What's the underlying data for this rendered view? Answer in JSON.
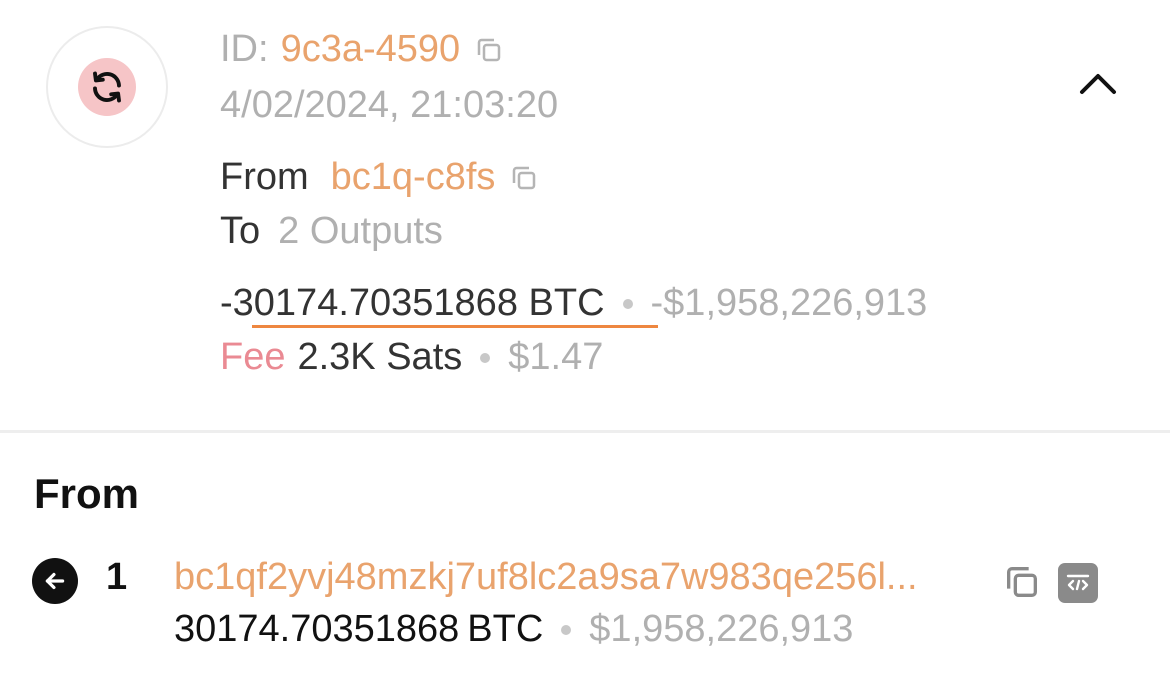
{
  "tx": {
    "id_label": "ID:",
    "id_value": "9c3a-4590",
    "datetime": "4/02/2024, 21:03:20",
    "from_label": "From",
    "from_address": "bc1q-c8fs",
    "to_label": "To",
    "to_value": "2 Outputs",
    "amount": "-30174.70351868 BTC",
    "amount_usd": "-$1,958,226,913",
    "fee_label": "Fee",
    "fee_value": "2.3K Sats",
    "fee_usd": "$1.47",
    "icon": "refresh-icon",
    "expand_icon": "chevron-up-icon"
  },
  "from_section": {
    "title": "From",
    "inputs": [
      {
        "index": "1",
        "address": "bc1qf2yvj48mzkj7uf8lc2a9sa7w983qe256l...",
        "amount_num": "30174.70351868",
        "amount_unit": "BTC",
        "amount_usd": "$1,958,226,913"
      }
    ]
  },
  "colors": {
    "accent": "#e9a36d",
    "fee": "#ea8a93",
    "icon_bg": "#f6c5c7",
    "underline": "#ee8740"
  }
}
